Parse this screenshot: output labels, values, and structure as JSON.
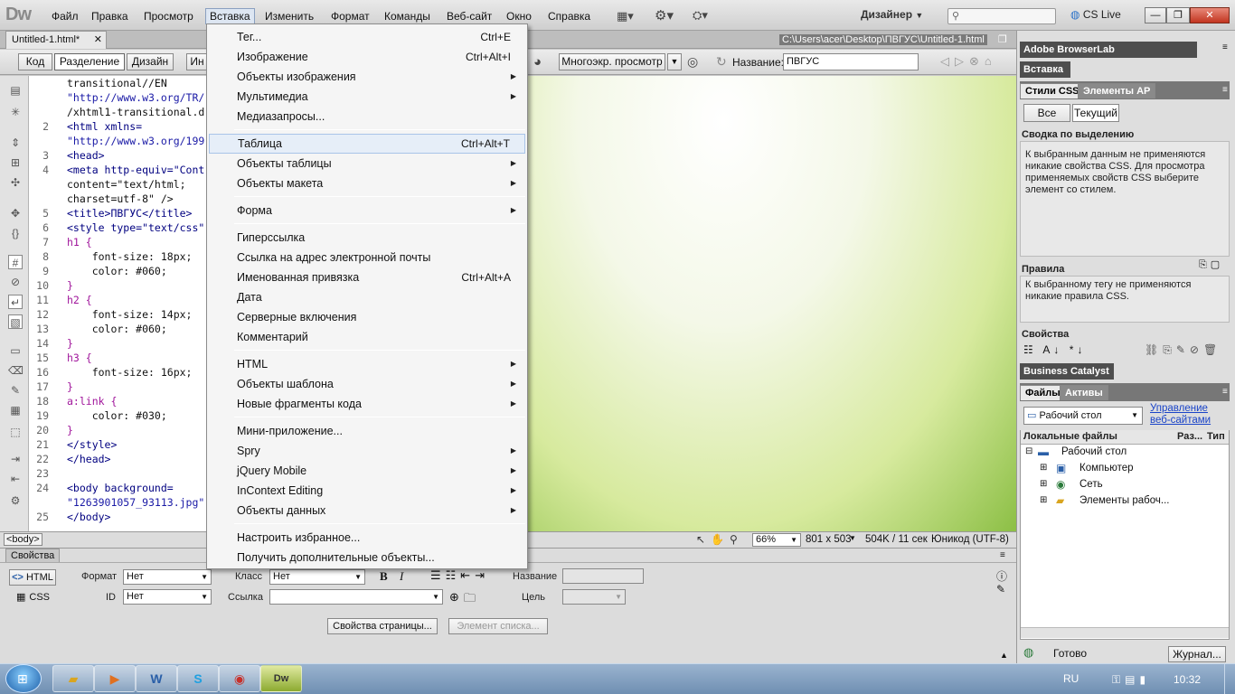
{
  "app": {
    "logo": "Dw",
    "designer_label": "Дизайнер",
    "cs_live": "CS Live"
  },
  "menu": [
    "Файл",
    "Правка",
    "Просмотр",
    "Вставка",
    "Изменить",
    "Формат",
    "Команды",
    "Веб-сайт",
    "Окно",
    "Справка"
  ],
  "document": {
    "tab": "Untitled-1.html*",
    "path": "C:\\Users\\acer\\Desktop\\ПВГУС\\Untitled-1.html"
  },
  "toolbar": {
    "code": "Код",
    "split": "Разделение",
    "design": "Дизайн",
    "live_partial": "Ин",
    "multiscreen": "Многоэкр. просмотр",
    "title_label": "Название:",
    "title_value": "ПВГУС"
  },
  "code_lines": [
    {
      "n": "",
      "t": "transitional//EN"
    },
    {
      "n": "",
      "t": "\"http://www.w3.org/TR/"
    },
    {
      "n": "",
      "t": "/xhtml1-transitional.d"
    },
    {
      "n": "2",
      "t": "<html xmlns="
    },
    {
      "n": "",
      "t": "\"http://www.w3.org/199"
    },
    {
      "n": "3",
      "t": "<head>"
    },
    {
      "n": "4",
      "t": "<meta http-equiv=\"Cont"
    },
    {
      "n": "",
      "t": "content=\"text/html;"
    },
    {
      "n": "",
      "t": "charset=utf-8\" />"
    },
    {
      "n": "5",
      "t": "<title>ПВГУС</title>"
    },
    {
      "n": "6",
      "t": "<style type=\"text/css\""
    },
    {
      "n": "7",
      "t": "h1 {"
    },
    {
      "n": "8",
      "t": "    font-size: 18px;"
    },
    {
      "n": "9",
      "t": "    color: #060;"
    },
    {
      "n": "10",
      "t": "}"
    },
    {
      "n": "11",
      "t": "h2 {"
    },
    {
      "n": "12",
      "t": "    font-size: 14px;"
    },
    {
      "n": "13",
      "t": "    color: #060;"
    },
    {
      "n": "14",
      "t": "}"
    },
    {
      "n": "15",
      "t": "h3 {"
    },
    {
      "n": "16",
      "t": "    font-size: 16px;"
    },
    {
      "n": "17",
      "t": "}"
    },
    {
      "n": "18",
      "t": "a:link {"
    },
    {
      "n": "19",
      "t": "    color: #030;"
    },
    {
      "n": "20",
      "t": "}"
    },
    {
      "n": "21",
      "t": "</style>"
    },
    {
      "n": "22",
      "t": "</head>"
    },
    {
      "n": "23",
      "t": ""
    },
    {
      "n": "24",
      "t": "<body background="
    },
    {
      "n": "",
      "t": "\"1263901057_93113.jpg\""
    },
    {
      "n": "25",
      "t": "</body>"
    }
  ],
  "dropdown": [
    {
      "label": "Тег...",
      "shortcut": "Ctrl+E"
    },
    {
      "label": "Изображение",
      "shortcut": "Ctrl+Alt+I"
    },
    {
      "label": "Объекты изображения",
      "sub": true
    },
    {
      "label": "Мультимедиа",
      "sub": true
    },
    {
      "label": "Медиазапросы..."
    },
    {
      "sep": true
    },
    {
      "label": "Таблица",
      "shortcut": "Ctrl+Alt+T",
      "highlight": true
    },
    {
      "label": "Объекты таблицы",
      "sub": true
    },
    {
      "label": "Объекты макета",
      "sub": true
    },
    {
      "sep": true
    },
    {
      "label": "Форма",
      "sub": true
    },
    {
      "sep": true
    },
    {
      "label": "Гиперссылка"
    },
    {
      "label": "Ссылка на адрес электронной почты"
    },
    {
      "label": "Именованная привязка",
      "shortcut": "Ctrl+Alt+A"
    },
    {
      "label": "Дата"
    },
    {
      "label": "Серверные включения"
    },
    {
      "label": "Комментарий"
    },
    {
      "sep": true
    },
    {
      "label": "HTML",
      "sub": true
    },
    {
      "label": "Объекты шаблона",
      "sub": true
    },
    {
      "label": "Новые фрагменты кода",
      "sub": true
    },
    {
      "sep": true
    },
    {
      "label": "Мини-приложение..."
    },
    {
      "label": "Spry",
      "sub": true
    },
    {
      "label": "jQuery Mobile",
      "sub": true
    },
    {
      "label": "InContext Editing",
      "sub": true
    },
    {
      "label": "Объекты данных",
      "sub": true
    },
    {
      "sep": true
    },
    {
      "label": "Настроить избранное..."
    },
    {
      "label": "Получить дополнительные объекты..."
    }
  ],
  "status": {
    "body_tag": "<body>",
    "zoom": "66%",
    "dimensions": "801 x 503",
    "size_time": "504K / 11 сек",
    "encoding": "Юникод (UTF-8)"
  },
  "properties": {
    "tab": "Свойства",
    "html": "HTML",
    "css": "CSS",
    "format_label": "Формат",
    "format_value": "Нет",
    "id_label": "ID",
    "id_value": "Нет",
    "class_label": "Класс",
    "class_value": "Нет",
    "link_label": "Ссылка",
    "name_label": "Название",
    "target_label": "Цель",
    "page_props": "Свойства страницы...",
    "list_item": "Элемент списка..."
  },
  "right": {
    "browserlab": "Adobe BrowserLab",
    "insert": "Вставка",
    "css_styles": "Стили CSS",
    "ap_elements": "Элементы AP",
    "all": "Все",
    "current": "Текущий",
    "summary_title": "Сводка по выделению",
    "summary_text": "К выбранным данным не применяются никакие свойства CSS.  Для просмотра применяемых свойств CSS выберите элемент со стилем.",
    "rules_title": "Правила",
    "rules_text": "К выбранному тегу не применяются никакие правила CSS.",
    "props_title": "Свойства",
    "business_catalyst": "Business Catalyst",
    "files": "Файлы",
    "assets": "Активы",
    "location": "Рабочий стол",
    "manage_sites": "Управление веб-сайтами",
    "col_local": "Локальные файлы",
    "col_size": "Раз...",
    "col_type": "Тип",
    "tree": [
      "Рабочий стол",
      "Компьютер",
      "Сеть",
      "Элементы рабоч..."
    ],
    "ready": "Готово",
    "log": "Журнал..."
  },
  "taskbar": {
    "lang": "RU",
    "time": "10:32"
  }
}
